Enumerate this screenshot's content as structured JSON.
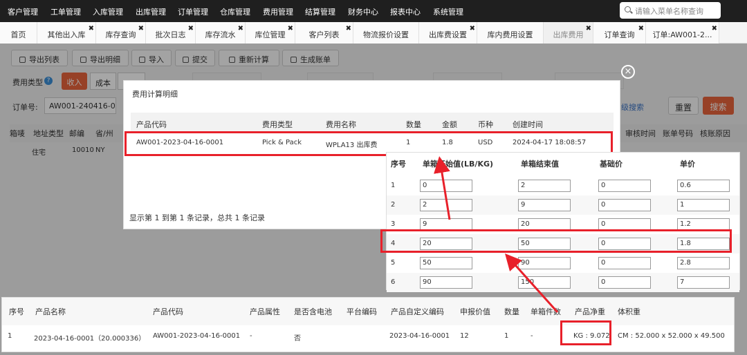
{
  "topnav": {
    "items": [
      "客户管理",
      "工单管理",
      "入库管理",
      "出库管理",
      "订单管理",
      "仓库管理",
      "费用管理",
      "结算管理",
      "财务中心",
      "报表中心",
      "系统管理"
    ],
    "search_placeholder": "请输入菜单名称查询"
  },
  "tabs": [
    "首页",
    "其他出入库",
    "库存查询",
    "批次日志",
    "库存流水",
    "库位管理",
    "客户列表",
    "物流报价设置",
    "出库费设置",
    "库内费用设置",
    "出库费用",
    "订单查询",
    "订单:AW001-2..."
  ],
  "toolbar": [
    "导出列表",
    "导出明细",
    "导入",
    "提交",
    "重新计算",
    "生成账单"
  ],
  "filters": {
    "fee_type_label": "费用类型",
    "income": "收入",
    "cost": "成本",
    "order_label": "订单号:",
    "order_value": "AW001-240416-0(",
    "reset": "重置",
    "search": "搜索",
    "adv_search": "级搜索"
  },
  "bg_table": {
    "headers": [
      "箱唛",
      "地址类型",
      "邮编",
      "省/州"
    ],
    "right_headers": [
      "审核时间",
      "账单号码",
      "核账原因"
    ],
    "row": [
      "住宅",
      "10010",
      "NY"
    ]
  },
  "modal": {
    "title": "费用计算明细",
    "headers": [
      "产品代码",
      "费用类型",
      "费用名称",
      "数量",
      "金额",
      "币种",
      "创建时间"
    ],
    "row": {
      "code": "AW001-2023-04-16-0001",
      "type": "Pick & Pack",
      "name": "WPLA13 出库费",
      "qty": "1",
      "amount": "1.8",
      "currency": "USD",
      "created": "2024-04-17 18:08:57"
    },
    "footer": "显示第 1 到第 1 条记录，总共 1 条记录"
  },
  "tier_table": {
    "headers": [
      "序号",
      "单箱开始值(LB/KG)",
      "单箱结束值",
      "基础价",
      "单价"
    ],
    "rows": [
      [
        "1",
        "0",
        "2",
        "0",
        "0.6"
      ],
      [
        "2",
        "2",
        "9",
        "0",
        "1"
      ],
      [
        "3",
        "9",
        "20",
        "0",
        "1.2"
      ],
      [
        "4",
        "20",
        "50",
        "0",
        "1.8"
      ],
      [
        "5",
        "50",
        "90",
        "0",
        "2.8"
      ],
      [
        "6",
        "90",
        "150",
        "0",
        "7"
      ]
    ]
  },
  "product_table": {
    "headers": [
      "序号",
      "产品名称",
      "产品代码",
      "产品属性",
      "是否含电池",
      "平台编码",
      "产品自定义编码",
      "申报价值",
      "数量",
      "单箱件数",
      "产品净重",
      "体积重"
    ],
    "row": [
      "1",
      "2023-04-16-0001（20.000336）",
      "AW001-2023-04-16-0001",
      "-",
      "否",
      "",
      "2023-04-16-0001",
      "12",
      "1",
      "-",
      "KG : 9.072",
      "CM : 52.000 x 52.000 x 49.500"
    ]
  },
  "colors": {
    "accent": "#e8202a",
    "orange": "#e8643c",
    "nav": "#1f1f1f"
  }
}
